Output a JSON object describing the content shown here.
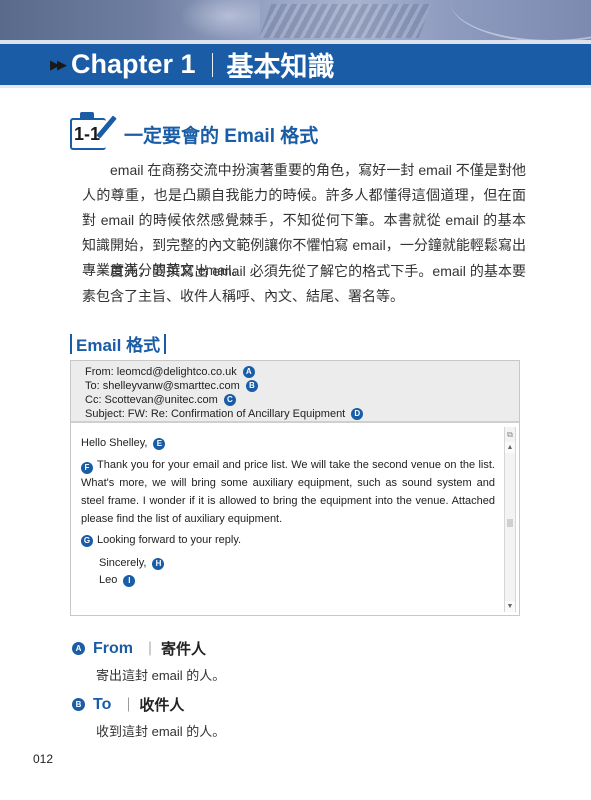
{
  "chapter": {
    "arrows": "▶▶",
    "title": "Chapter 1",
    "title_zh": "基本知識"
  },
  "section": {
    "number": "1-1",
    "title": "一定要會的 Email 格式"
  },
  "paragraphs": [
    "email 在商務交流中扮演著重要的角色，寫好一封 email 不僅是對他人的尊重，也是凸顯自我能力的時候。許多人都懂得這個道理，但在面對 email 的時候依然感覺棘手，不知從何下筆。本書就從 email 的基本知識開始，到完整的內文範例讓你不懼怕寫 email，一分鐘就能輕鬆寫出專業度滿分的英文 email。",
    "首先，要撰寫出 email 必須先從了解它的格式下手。email 的基本要素包含了主旨、收件人稱呼、內文、結尾、署名等。"
  ],
  "format_heading": "Email 格式",
  "email": {
    "header": [
      {
        "text": "From: leomcd@delightco.co.uk",
        "marker": "A"
      },
      {
        "text": "To: shelleyvanw@smarttec.com",
        "marker": "B"
      },
      {
        "text": "Cc: Scottevan@unitec.com",
        "marker": "C"
      },
      {
        "text": "Subject: FW: Re: Confirmation of Ancillary Equipment",
        "marker": "D"
      }
    ],
    "greeting": {
      "text": "Hello Shelley,",
      "marker": "E"
    },
    "body": {
      "marker": "F",
      "text": "Thank you for your email and price list. We will take the second venue on the list. What's more, we will bring some auxiliary equipment, such as sound system and steel frame. I wonder if it is allowed to bring the equipment into the venue. Attached please find the list of auxiliary equipment."
    },
    "closing_line": {
      "marker": "G",
      "text": "Looking forward to your reply."
    },
    "sign_off": {
      "text": "Sincerely,",
      "marker": "H"
    },
    "signature": {
      "text": "Leo",
      "marker": "I"
    },
    "scrollbar": {
      "up": "▲",
      "down": "▼",
      "corner": "⧉"
    }
  },
  "legend": [
    {
      "marker": "A",
      "en": "From",
      "sep": "｜",
      "zh": "寄件人",
      "desc": "寄出這封 email 的人。"
    },
    {
      "marker": "B",
      "en": "To",
      "sep": "｜",
      "zh": "收件人",
      "desc": "收到這封 email 的人。"
    }
  ],
  "page_number": "012",
  "colors": {
    "accent": "#1a5ca6",
    "header_bg": "#ececec"
  }
}
